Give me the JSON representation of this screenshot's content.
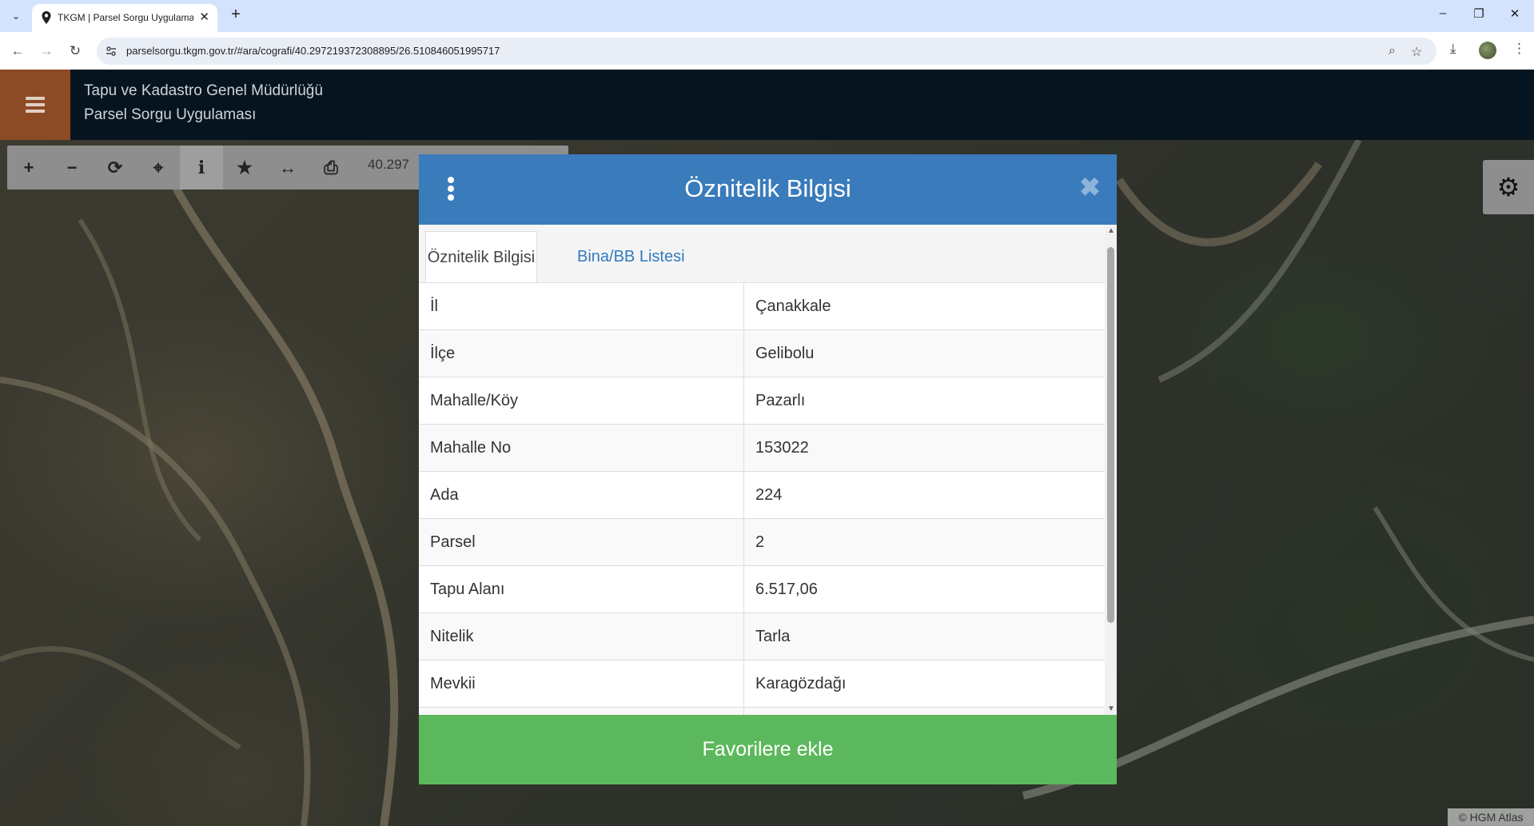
{
  "browser": {
    "tab_title": "TKGM | Parsel Sorgu Uygulaması",
    "tab_close": "✕",
    "new_tab": "+",
    "url": "parselsorgu.tkgm.gov.tr/#ara/cografi/40.297219372308895/26.510846051995717",
    "window": {
      "minimize": "–",
      "restore": "❐",
      "close": "✕"
    }
  },
  "app": {
    "title_line1": "Tapu ve Kadastro Genel Müdürlüğü",
    "title_line2": "Parsel Sorgu Uygulaması"
  },
  "map_toolbar": {
    "coordinate": "40.297",
    "buttons": [
      "zoom-in",
      "zoom-out",
      "refresh",
      "locate",
      "info",
      "favorite",
      "measure",
      "print"
    ]
  },
  "modal": {
    "title": "Öznitelik Bilgisi",
    "close": "✖",
    "tabs": [
      {
        "label": "Öznitelik Bilgisi",
        "active": true
      },
      {
        "label": "Bina/BB Listesi",
        "active": false
      }
    ],
    "rows": [
      {
        "key": "İl",
        "value": "Çanakkale"
      },
      {
        "key": "İlçe",
        "value": "Gelibolu"
      },
      {
        "key": "Mahalle/Köy",
        "value": "Pazarlı"
      },
      {
        "key": "Mahalle No",
        "value": "153022"
      },
      {
        "key": "Ada",
        "value": "224"
      },
      {
        "key": "Parsel",
        "value": "2"
      },
      {
        "key": "Tapu Alanı",
        "value": "6.517,06"
      },
      {
        "key": "Nitelik",
        "value": "Tarla"
      },
      {
        "key": "Mevkii",
        "value": "Karagözdağı"
      }
    ],
    "favorite_button": "Favorilere ekle"
  },
  "attribution": "© HGM Atlas",
  "colors": {
    "header_bg": "#06141f",
    "menu_bg": "#8c4a25",
    "modal_header": "#3a7bbb",
    "favorite_btn": "#5cb85c",
    "tab_link": "#2f7bbf"
  }
}
